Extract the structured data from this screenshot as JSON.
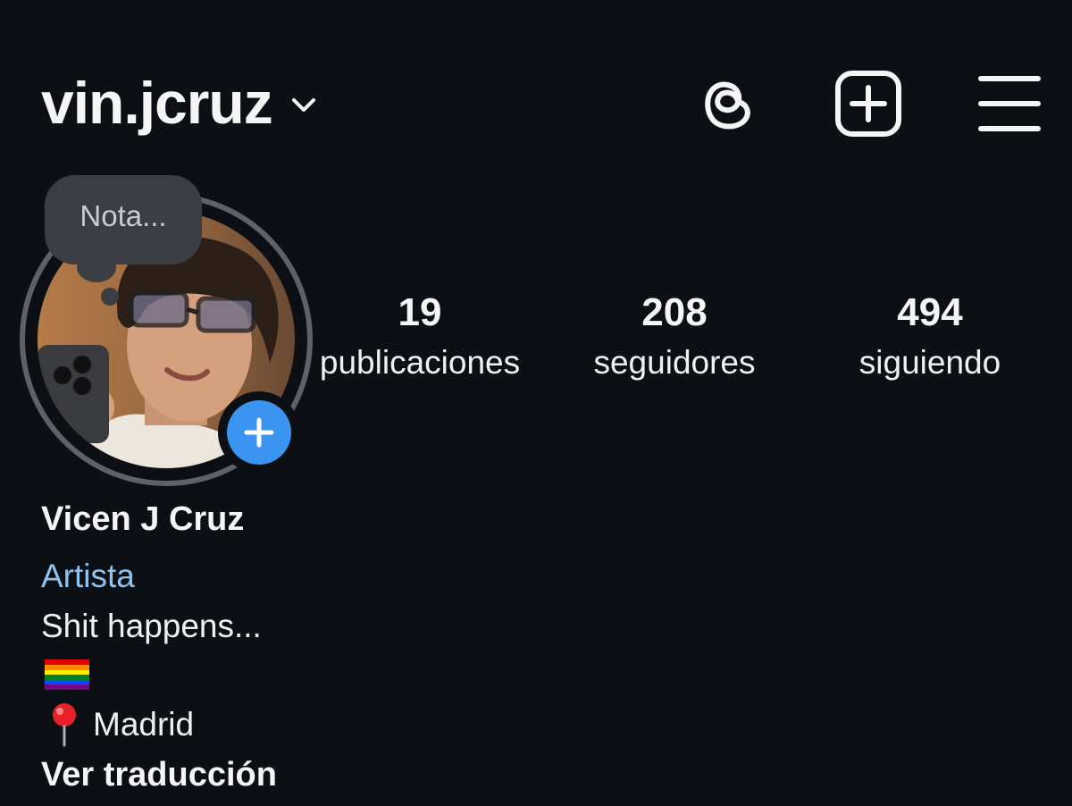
{
  "header": {
    "username": "vin.jcruz",
    "icons": [
      "chevron-down-icon",
      "threads-icon",
      "new-post-icon",
      "menu-icon"
    ]
  },
  "note": {
    "placeholder": "Nota..."
  },
  "stats": {
    "posts": {
      "count": "19",
      "label": "publicaciones"
    },
    "followers": {
      "count": "208",
      "label": "seguidores"
    },
    "following": {
      "count": "494",
      "label": "siguiendo"
    }
  },
  "bio": {
    "full_name": "Vicen J Cruz",
    "category": "Artista",
    "line1": "Shit happens...",
    "flag": "rainbow-flag-icon",
    "location": "Madrid",
    "location_icon": "pin-icon",
    "translate": "Ver traducción"
  },
  "colors": {
    "background": "#0c0f14",
    "text": "#f5f5f5",
    "category": "#8fc3ef",
    "accent_blue": "#3b94f0",
    "note_bubble": "#3a3d42",
    "avatar_ring": "#5d6268"
  }
}
